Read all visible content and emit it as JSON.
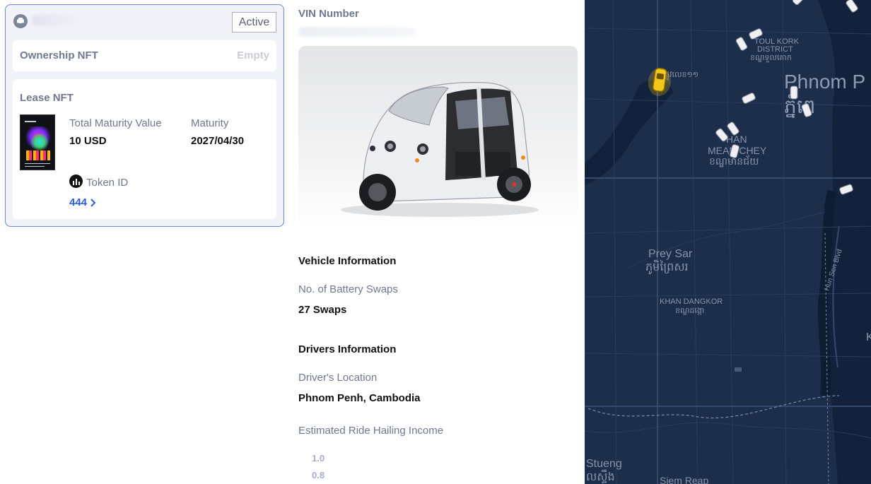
{
  "vehicle_card": {
    "status": "Active",
    "ownership": {
      "label": "Ownership NFT",
      "value": "Empty"
    },
    "lease": {
      "label": "Lease NFT",
      "total_maturity_value_label": "Total Maturity Value",
      "total_maturity_value": "10 USD",
      "maturity_label": "Maturity",
      "maturity": "2027/04/30",
      "token_id_label": "Token ID",
      "token_id": "444"
    }
  },
  "details": {
    "vin_label": "VIN Number",
    "vehicle_info_heading": "Vehicle Information",
    "battery_swaps_label": "No. of Battery Swaps",
    "battery_swaps_value": "27 Swaps",
    "drivers_info_heading": "Drivers Information",
    "driver_location_label": "Driver's Location",
    "driver_location_value": "Phnom Penh, Cambodia",
    "income_label": "Estimated Ride Hailing Income",
    "income_chart_ticks": [
      "1.0",
      "0.8"
    ]
  },
  "map": {
    "labels": {
      "toul_kork_1": "TOUL KORK",
      "toul_kork_2": "DISTRICT",
      "toul_kork_km": "ខណ្ឌទួលគោក",
      "road_km": "ផ្លូវលេខ១១",
      "phnom_penh": "Phnom P",
      "phnom_penh_km": "ភ្នំពេ",
      "khan_1": "HAN",
      "khan_2": "MEAN CHEY",
      "khan_km": "ខណ្ឌមានជ័យ",
      "prey_sar": "Prey Sar",
      "prey_sar_km": "ភូមិព្រៃសរ",
      "dangkor_1": "KHAN DANGKOR",
      "dangkor_km": "ខណ្ឌដង្កោ",
      "hun_sen": "Hun Sen Blvd",
      "stueng": "Stueng",
      "stueng_km": "លស្ទឹង",
      "siem_reap": "Siem Reap",
      "k": "K"
    },
    "colors": {
      "land": "#1d2e4b",
      "water": "#13223a",
      "selected_vehicle": "#f2c81c",
      "vehicle": "#eef0f3"
    }
  }
}
